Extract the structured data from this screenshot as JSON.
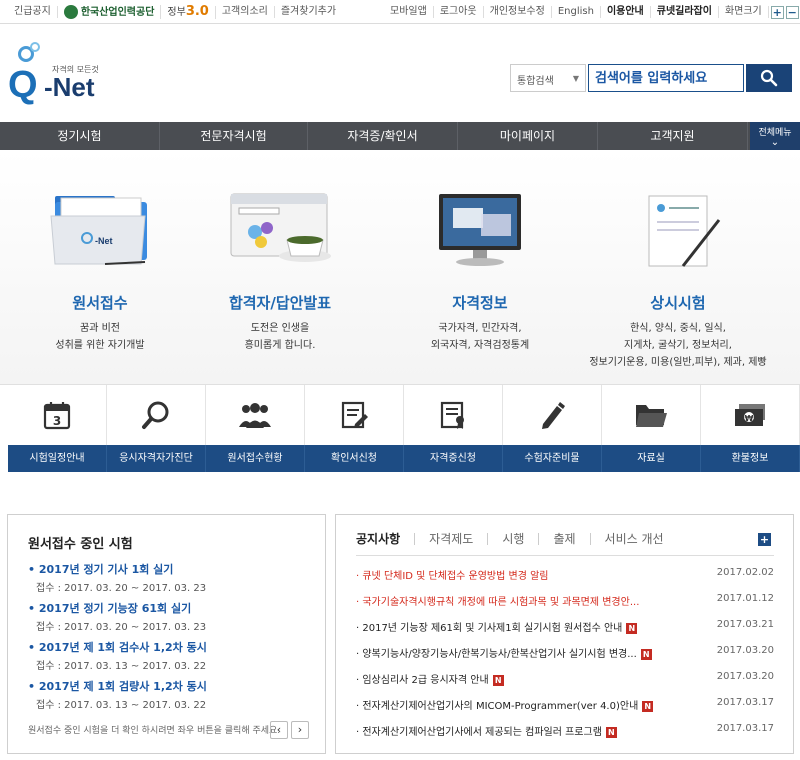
{
  "topbar": {
    "emergency": "긴급공지",
    "org_name": "한국산업인력공단",
    "gov_prefix": "정부",
    "gov_num": "3.0",
    "links": [
      "고객의소리",
      "즐겨찾기추가"
    ],
    "user_links": [
      "모바일앱",
      "로그아웃",
      "개인정보수정",
      "English",
      "이용안내",
      "큐넷길라잡이",
      "화면크기"
    ],
    "zoom_in": "+",
    "zoom_out": "−"
  },
  "logo": {
    "tagline": "자격의 모든것",
    "q": "Q",
    "net": "-Net"
  },
  "search": {
    "scope": "통합검색",
    "placeholder": "검색어를 입력하세요"
  },
  "nav": {
    "items": [
      "정기시험",
      "전문자격시험",
      "자격증/확인서",
      "마이페이지",
      "고객지원"
    ],
    "all_menu": "전체메뉴"
  },
  "hero": [
    {
      "title": "원서접수",
      "desc": [
        "꿈과 비전",
        "성취를 위한 자기개발"
      ]
    },
    {
      "title": "합격자/답안발표",
      "desc": [
        "도전은 인생을",
        "흥미롭게 합니다."
      ]
    },
    {
      "title": "자격정보",
      "desc": [
        "국가자격, 민간자격,",
        "외국자격, 자격검정통계"
      ]
    },
    {
      "title": "상시시험",
      "desc": [
        "한식, 양식, 중식, 일식,",
        "지게차, 굴삭기, 정보처리,",
        "정보기기운용, 미용(일반,피부), 제과, 제빵"
      ]
    }
  ],
  "quick": [
    {
      "label": "시험일정안내",
      "icon": "calendar-icon",
      "day": "3"
    },
    {
      "label": "응시자격자가진단",
      "icon": "search-icon"
    },
    {
      "label": "원서접수현황",
      "icon": "people-icon"
    },
    {
      "label": "확인서신청",
      "icon": "form-edit-icon"
    },
    {
      "label": "자격증신청",
      "icon": "certificate-icon"
    },
    {
      "label": "수험자준비물",
      "icon": "pencil-icon"
    },
    {
      "label": "자료실",
      "icon": "folder-icon"
    },
    {
      "label": "환불정보",
      "icon": "money-icon"
    }
  ],
  "exam_panel": {
    "title": "원서접수 중인 시험",
    "items": [
      {
        "title": "2017년 정기 기사 1회 실기",
        "period": "접수 : 2017. 03. 20 ~ 2017. 03. 23"
      },
      {
        "title": "2017년 정기 기능장 61회 실기",
        "period": "접수 : 2017. 03. 20 ~ 2017. 03. 23"
      },
      {
        "title": "2017년 제 1회 검수사 1,2차 동시",
        "period": "접수 : 2017. 03. 13 ~ 2017. 03. 22"
      },
      {
        "title": "2017년 제 1회 검량사 1,2차 동시",
        "period": "접수 : 2017. 03. 13 ~ 2017. 03. 22"
      }
    ],
    "footer": "원서접수 중인 시험을 더 확인 하시려면 좌우 버튼을 클릭해 주세요.",
    "prev": "‹",
    "next": "›"
  },
  "notice_panel": {
    "tabs": [
      "공지사항",
      "자격제도",
      "시행",
      "출제",
      "서비스 개선"
    ],
    "more": "+",
    "new_badge": "N",
    "rows": [
      {
        "title": "큐넷 단체ID 및 단체접수 운영방법 변경 알림",
        "date": "2017.02.02",
        "red": true,
        "new": false
      },
      {
        "title": "국가기술자격시행규칙 개정에 따른 시험과목 및 과목면제 변경안...",
        "date": "2017.01.12",
        "red": true,
        "new": false
      },
      {
        "title": "2017년 기능장 제61회 및 기사제1회 실기시험 원서접수 안내",
        "date": "2017.03.21",
        "red": false,
        "new": true
      },
      {
        "title": "양복기능사/양장기능사/한복기능사/한복산업기사 실기시험 변경...",
        "date": "2017.03.20",
        "red": false,
        "new": true
      },
      {
        "title": "임상심리사 2급 응시자격 안내",
        "date": "2017.03.20",
        "red": false,
        "new": true
      },
      {
        "title": "전자계산기제어산업기사의 MICOM-Programmer(ver 4.0)안내",
        "date": "2017.03.17",
        "red": false,
        "new": true
      },
      {
        "title": "전자계산기제어산업기사에서 제공되는 컴파일러 프로그램",
        "date": "2017.03.17",
        "red": false,
        "new": true
      }
    ]
  },
  "colors": {
    "brand_blue": "#1e67b0",
    "nav_dark": "#4a4d52",
    "quick_blue": "#1d4c84",
    "alert_red": "#d4281b"
  }
}
